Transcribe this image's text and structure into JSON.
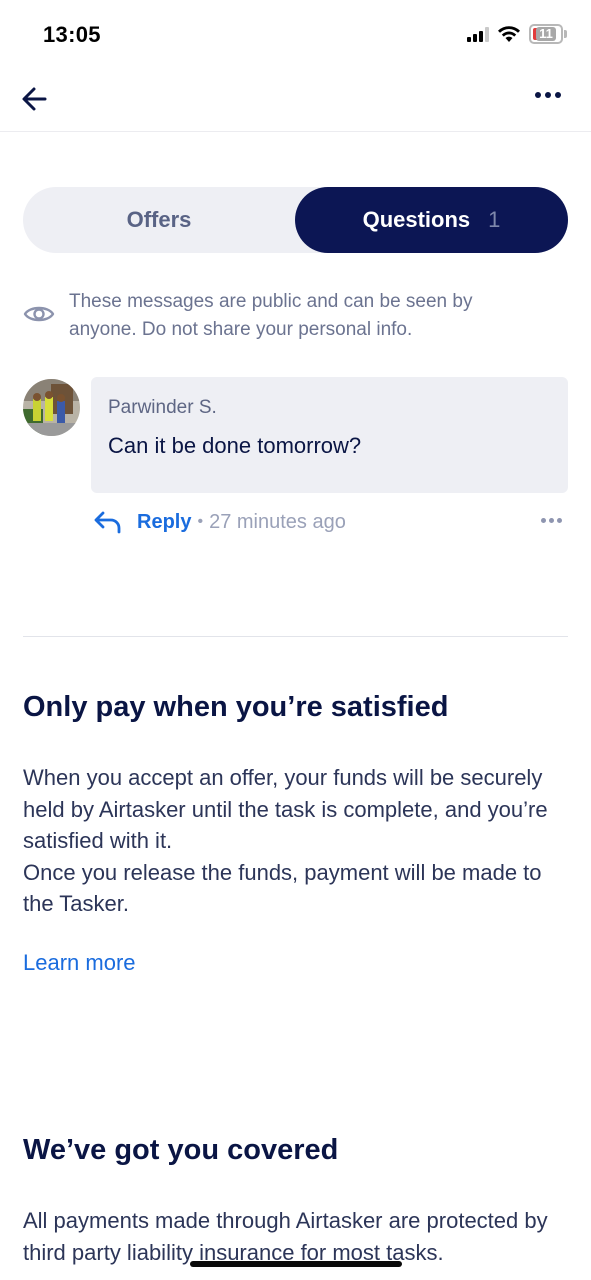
{
  "status_bar": {
    "time": "13:05",
    "battery": "11"
  },
  "tabs": {
    "offers_label": "Offers",
    "questions_label": "Questions",
    "questions_count": "1"
  },
  "notice": "These messages are public and can be seen by anyone. Do not share your personal info.",
  "question": {
    "author": "Parwinder  S.",
    "text": "Can it be done tomorrow?",
    "reply_label": "Reply",
    "separator": "•",
    "time_ago": "27 minutes ago"
  },
  "pay_section": {
    "title": "Only pay when you’re satisfied",
    "paragraph_1": "When you accept an offer, your funds will be securely held by Airtasker until the task is complete, and you’re satisfied with it.",
    "paragraph_2": "Once you release the funds, payment will be made to the Tasker.",
    "link": "Learn more"
  },
  "covered_section": {
    "title": "We’ve got you covered",
    "body": "All payments made through Airtasker are protected by third party liability insurance for most tasks."
  },
  "colors": {
    "navy": "#0c1654",
    "link_blue": "#1a6cde",
    "muted": "#6b7390"
  }
}
